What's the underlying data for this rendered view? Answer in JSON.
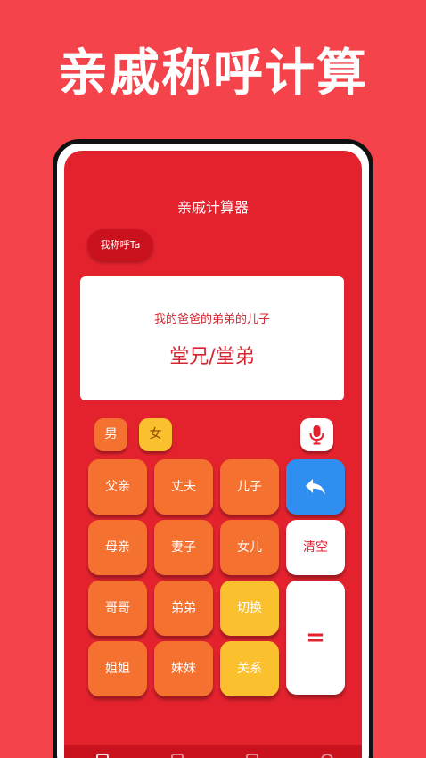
{
  "headline": "亲戚称呼计算",
  "app": {
    "title": "亲戚计算器",
    "mode_chip": "我称呼Ta"
  },
  "result": {
    "query": "我的爸爸的弟弟的儿子",
    "answer": "堂兄/堂弟"
  },
  "gender": {
    "male": "男",
    "female": "女"
  },
  "keys": {
    "father": "父亲",
    "husband": "丈夫",
    "son": "儿子",
    "mother": "母亲",
    "wife": "妻子",
    "daughter": "女儿",
    "clear": "清空",
    "elder_brother": "哥哥",
    "younger_brother": "弟弟",
    "switch": "切换",
    "elder_sister": "姐姐",
    "younger_sister": "妹妹",
    "relation": "关系",
    "equals": "="
  },
  "icons": {
    "mic": "microphone-icon",
    "back": "undo-arrow-icon"
  },
  "colors": {
    "background": "#f4434a",
    "screen": "#e3222e",
    "key_orange": "#f47130",
    "key_yellow": "#fbc02e",
    "key_blue": "#2e8ff0"
  }
}
